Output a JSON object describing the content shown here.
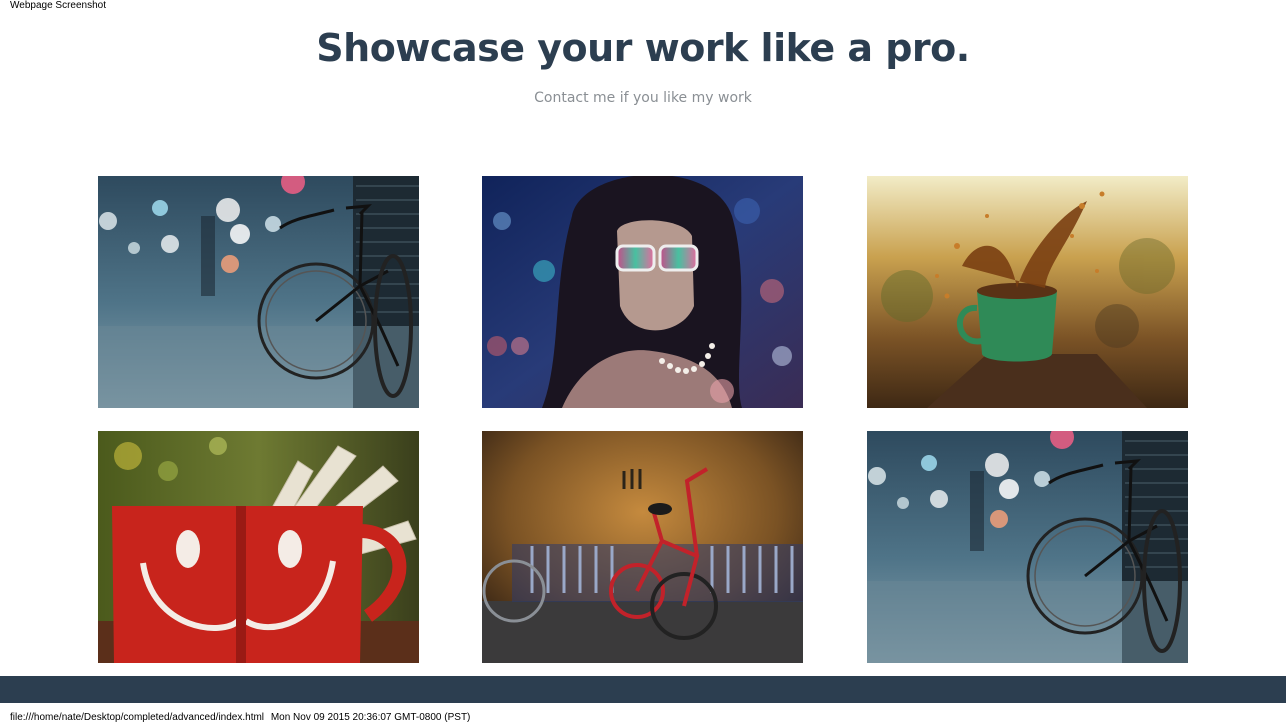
{
  "print_header": {
    "title": "Webpage Screenshot"
  },
  "hero": {
    "title": "Showcase your work like a pro.",
    "subtitle": "Contact me if you like my work"
  },
  "gallery": {
    "items": [
      {
        "subject": "bicycle-street"
      },
      {
        "subject": "woman-sunglasses"
      },
      {
        "subject": "coffee-splash"
      },
      {
        "subject": "smiley-mugs"
      },
      {
        "subject": "red-bicycle-wall"
      },
      {
        "subject": "bicycle-street"
      }
    ]
  },
  "footer": {
    "color": "#2c3e50"
  },
  "print_footer": {
    "path": "file:///home/nate/Desktop/completed/advanced/index.html",
    "datetime": "Mon Nov 09 2015 20:36:07 GMT-0800 (PST)"
  },
  "colors": {
    "heading": "#2c3e50",
    "subtext": "#8a8f94"
  }
}
